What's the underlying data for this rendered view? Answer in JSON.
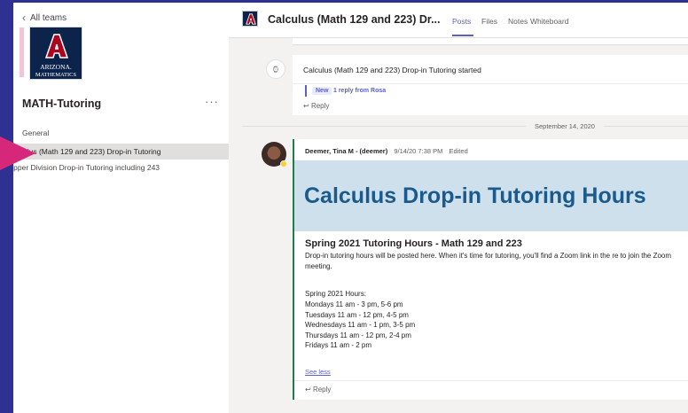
{
  "sidebar": {
    "back_label": "All teams",
    "logo": {
      "line1": "ARIZONA.",
      "line2": "MATHEMATICS"
    },
    "team_name": "MATH-Tutoring",
    "more_label": "···",
    "channels": [
      {
        "label": "General"
      },
      {
        "label": "Calculus (Math 129 and 223) Drop-in Tutoring"
      },
      {
        "label": "Upper Division Drop-in Tutoring including 243"
      }
    ]
  },
  "header": {
    "title": "Calculus (Math 129 and 223) Dr...",
    "tabs": [
      {
        "label": "Posts"
      },
      {
        "label": "Files"
      },
      {
        "label": "Notes"
      },
      {
        "label": "Whiteboard"
      }
    ]
  },
  "meeting": {
    "text": "Calculus (Math 129 and 223) Drop-in Tutoring started",
    "badge": "New",
    "reply_summary": "1 reply from Rosa",
    "reply_label": "Reply"
  },
  "date_separator": "September 14, 2020",
  "post": {
    "author": "Deemer, Tina M - (deemer)",
    "time": "9/14/20 7:38 PM",
    "edited": "Edited",
    "banner": "Calculus Drop-in Tutoring Hours",
    "subheading": "Spring 2021 Tutoring Hours - Math 129 and 223",
    "body": "Drop-in tutoring hours will be posted here.  When it's time for tutoring, you'll find a Zoom link in the re to join the Zoom meeting.",
    "hours_title": "Spring 2021 Hours:",
    "hours": [
      "Mondays 11 am - 3 pm, 5-6 pm",
      "Tuesdays 11 am - 12 pm, 4-5 pm",
      "Wednesdays 11 am - 1 pm, 3-5 pm",
      "Thursdays 11 am - 12 pm, 2-4 pm",
      "Fridays 11 am - 2 pm"
    ],
    "see_less": "See less",
    "reply_label": "Reply"
  },
  "colors": {
    "background_navy": "#2e3191",
    "accent_purple": "#5b5fc7",
    "arrow_pink": "#d5287a",
    "post_accent_green": "#237b4b",
    "banner_blue": "#cfe0ed",
    "banner_text": "#1b5a8c"
  }
}
